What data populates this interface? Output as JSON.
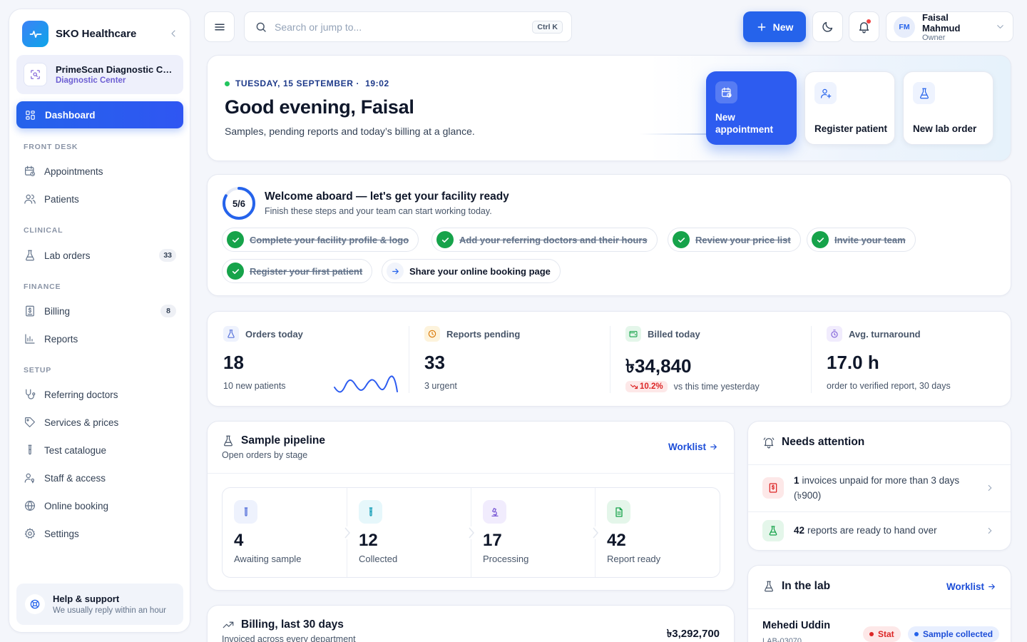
{
  "app": {
    "name": "SKO Healthcare"
  },
  "facility": {
    "name": "PrimeScan Diagnostic Center",
    "type": "Diagnostic Center"
  },
  "sidebar": {
    "active": "Dashboard",
    "sections": {
      "front_desk": "FRONT DESK",
      "clinical": "CLINICAL",
      "finance": "FINANCE",
      "setup": "SETUP"
    },
    "items": {
      "appointments": "Appointments",
      "patients": "Patients",
      "lab_orders": "Lab orders",
      "lab_orders_badge": "33",
      "billing": "Billing",
      "billing_badge": "8",
      "reports": "Reports",
      "referring_doctors": "Referring doctors",
      "services_prices": "Services & prices",
      "test_catalogue": "Test catalogue",
      "staff_access": "Staff & access",
      "online_booking": "Online booking",
      "settings": "Settings"
    },
    "help": {
      "title": "Help & support",
      "subtitle": "We usually reply within an hour"
    }
  },
  "topbar": {
    "search_placeholder": "Search or jump to...",
    "search_shortcut": "Ctrl K",
    "new_label": "New",
    "user": {
      "initials": "FM",
      "name": "Faisal Mahmud",
      "role": "Owner"
    }
  },
  "hero": {
    "date": "TUESDAY, 15 SEPTEMBER ·",
    "time": "19:02",
    "greeting": "Good evening, Faisal",
    "subtitle": "Samples, pending reports and today’s billing at a glance.",
    "actions": {
      "new_appointment": "New appointment",
      "register_patient": "Register patient",
      "new_lab_order": "New lab order"
    }
  },
  "onboarding": {
    "progress_label": "5/6",
    "progress": 0.833,
    "title": "Welcome aboard — let's get your facility ready",
    "subtitle": "Finish these steps and your team can start working today.",
    "steps": [
      {
        "label": "Complete your facility profile & logo",
        "done": true
      },
      {
        "label": "Add your referring doctors and their hours",
        "done": true
      },
      {
        "label": "Review your price list",
        "done": true
      },
      {
        "label": "Invite your team",
        "done": true
      },
      {
        "label": "Register your first patient",
        "done": true
      },
      {
        "label": "Share your online booking page",
        "done": false
      }
    ]
  },
  "stats": {
    "orders": {
      "label": "Orders today",
      "value": "18",
      "sub": "10 new patients"
    },
    "reports": {
      "label": "Reports pending",
      "value": "33",
      "sub": "3 urgent"
    },
    "billed": {
      "label": "Billed today",
      "value": "৳34,840",
      "trend": "10.2%",
      "sub": "vs this time yesterday"
    },
    "turnaround": {
      "label": "Avg. turnaround",
      "value": "17.0 h",
      "sub": "order to verified report, 30 days"
    }
  },
  "pipeline": {
    "title": "Sample pipeline",
    "subtitle": "Open orders by stage",
    "link": "Worklist",
    "stages": [
      {
        "count": "4",
        "label": "Awaiting sample"
      },
      {
        "count": "12",
        "label": "Collected"
      },
      {
        "count": "17",
        "label": "Processing"
      },
      {
        "count": "42",
        "label": "Report ready"
      }
    ]
  },
  "billing": {
    "title": "Billing, last 30 days",
    "subtitle": "Invoiced across every department",
    "total": "৳3,292,700"
  },
  "attention": {
    "title": "Needs attention",
    "items": [
      {
        "count": "1",
        "text": "invoices unpaid for more than 3 days (৳900)"
      },
      {
        "count": "42",
        "text": "reports are ready to hand over"
      }
    ]
  },
  "in_lab": {
    "title": "In the lab",
    "link": "Worklist",
    "patient": {
      "name": "Mehedi Uddin",
      "id": "LAB-03070",
      "priority": "Stat",
      "status": "Sample collected"
    }
  },
  "colors": {
    "primary": "#2563eb",
    "success": "#16a34a",
    "danger": "#dc2626",
    "warning": "#d97706"
  }
}
